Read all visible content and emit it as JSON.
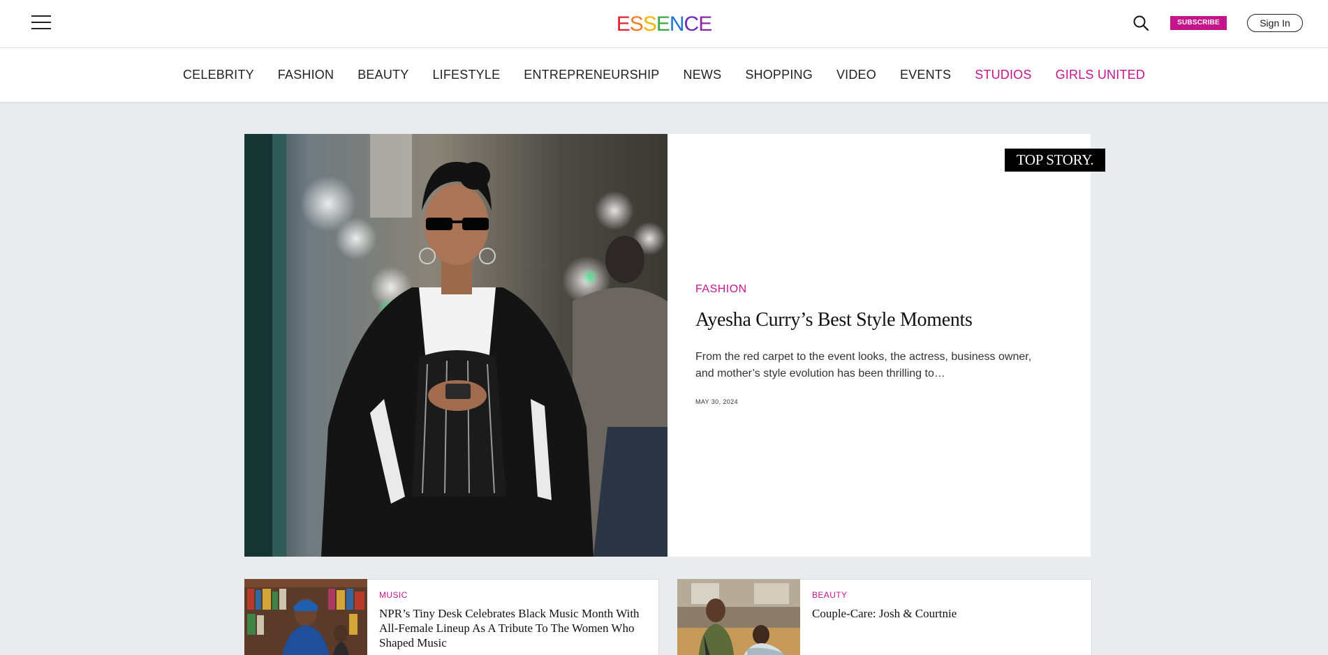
{
  "header": {
    "logo_text": [
      "E",
      "S",
      "S",
      "E",
      "N",
      "C",
      "E"
    ],
    "subscribe_label": "SUBSCRIBE",
    "signin_label": "Sign In"
  },
  "nav": {
    "items": [
      {
        "label": "CELEBRITY",
        "highlight": false
      },
      {
        "label": "FASHION",
        "highlight": false
      },
      {
        "label": "BEAUTY",
        "highlight": false
      },
      {
        "label": "LIFESTYLE",
        "highlight": false
      },
      {
        "label": "ENTREPRENEURSHIP",
        "highlight": false
      },
      {
        "label": "NEWS",
        "highlight": false
      },
      {
        "label": "SHOPPING",
        "highlight": false
      },
      {
        "label": "VIDEO",
        "highlight": false
      },
      {
        "label": "EVENTS",
        "highlight": false
      },
      {
        "label": "STUDIOS",
        "highlight": true
      },
      {
        "label": "GIRLS UNITED",
        "highlight": true
      }
    ]
  },
  "hero": {
    "badge": "TOP STORY.",
    "category": "FASHION",
    "title": "Ayesha Curry’s Best Style Moments",
    "description": "From the red carpet to the event looks, the actress, business owner, and mother’s style evolution has been thrilling to…",
    "date": "MAY 30, 2024"
  },
  "cards": [
    {
      "category": "MUSIC",
      "title": "NPR’s Tiny Desk Celebrates Black Music Month With All-Female Lineup As A Tribute To The Women Who Shaped Music"
    },
    {
      "category": "BEAUTY",
      "title": "Couple-Care: Josh & Courtnie"
    }
  ],
  "colors": {
    "accent": "#c4158d",
    "page_background": "#e8ecef"
  }
}
